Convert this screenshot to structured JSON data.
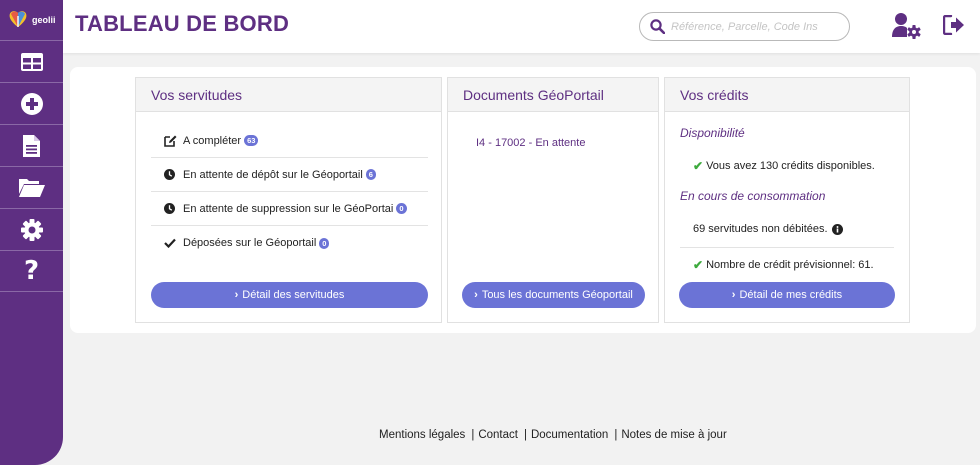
{
  "brand": {
    "name": "geolii"
  },
  "sidebar": {
    "items": [
      {
        "icon": "dashboard-icon"
      },
      {
        "icon": "plus-circle-icon"
      },
      {
        "icon": "document-icon"
      },
      {
        "icon": "folder-open-icon"
      },
      {
        "icon": "gear-icon"
      },
      {
        "icon": "question-icon"
      }
    ]
  },
  "header": {
    "title": "TABLEAU DE BORD",
    "search_placeholder": "Référence, Parcelle, Code Ins",
    "user_settings_icon": "user-cog-icon",
    "logout_icon": "sign-out-icon"
  },
  "servitudes": {
    "title": "Vos servitudes",
    "rows": [
      {
        "icon": "edit-icon",
        "label": "A compléter",
        "count": "63"
      },
      {
        "icon": "clock-icon",
        "label": "En attente de dépôt sur le Géoportail",
        "count": "6"
      },
      {
        "icon": "clock-icon",
        "label": "En attente de suppression sur le GéoPortai",
        "count": "0"
      },
      {
        "icon": "check-icon",
        "label": "Déposées sur le Géoportail",
        "count": "0"
      }
    ],
    "button": "Détail des servitudes"
  },
  "documents": {
    "title": "Documents GéoPortail",
    "items": [
      "I4 - 17002 - En attente"
    ],
    "button": "Tous les documents Géoportail"
  },
  "credits": {
    "title": "Vos crédits",
    "availability_heading": "Disponibilité",
    "available_text": "Vous avez 130 crédits disponibles.",
    "consumption_heading": "En cours de consommation",
    "not_debited_text": "69 servitudes non débitées.",
    "forecast_text": "Nombre de crédit prévisionnel: 61.",
    "button": "Détail de mes crédits"
  },
  "footer": {
    "links": [
      "Mentions légales",
      "Contact",
      "Documentation",
      "Notes de mise à jour"
    ],
    "separator": "|"
  },
  "colors": {
    "brand_purple": "#5e2f82",
    "button_blue": "#6b73d6",
    "check_green": "#3eaa3e"
  }
}
